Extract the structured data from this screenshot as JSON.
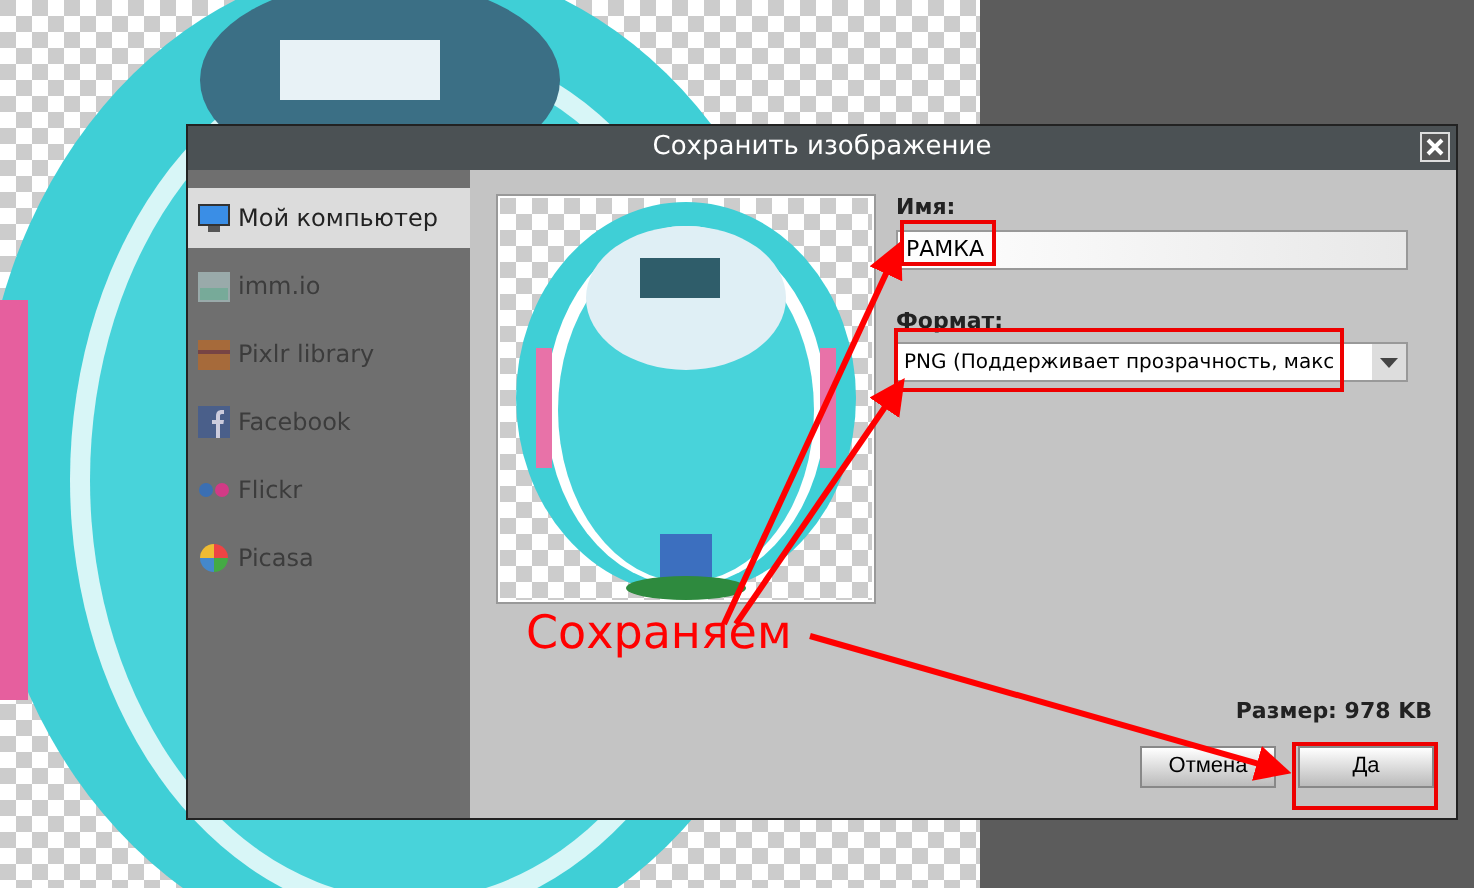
{
  "window": {
    "title": "Сохранить изображение"
  },
  "sidebar": {
    "items": [
      {
        "label": "Мой компьютер",
        "selected": true
      },
      {
        "label": "imm.io",
        "selected": false
      },
      {
        "label": "Pixlr library",
        "selected": false
      },
      {
        "label": "Facebook",
        "selected": false
      },
      {
        "label": "Flickr",
        "selected": false
      },
      {
        "label": "Picasa",
        "selected": false
      }
    ]
  },
  "form": {
    "name_label": "Имя:",
    "name_value": "РАМКА",
    "format_label": "Формат:",
    "format_value": "PNG (Поддерживает прозрачность, макс",
    "size": "Размер: 978 KB"
  },
  "buttons": [
    {
      "label": "Отмена"
    },
    {
      "label": "Да"
    }
  ],
  "annotation": {
    "label": "Сохраняем"
  }
}
